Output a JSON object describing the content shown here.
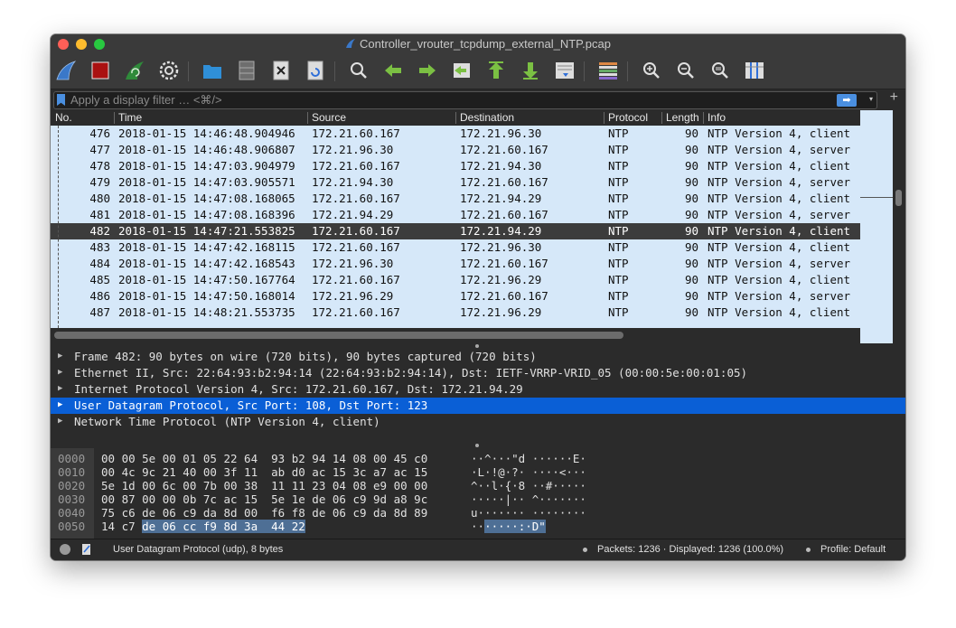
{
  "window": {
    "title": "Controller_vrouter_tcpdump_external_NTP.pcap"
  },
  "toolbar": {
    "buttons": [
      {
        "name": "start-capture",
        "icon": "shark-fin-icon"
      },
      {
        "name": "stop-capture",
        "icon": "stop-square-icon"
      },
      {
        "name": "restart-capture",
        "icon": "restart-fin-icon"
      },
      {
        "name": "capture-options",
        "icon": "gear-icon"
      },
      {
        "name": "open-file",
        "icon": "folder-icon"
      },
      {
        "name": "save-file",
        "icon": "file-cabinet-icon"
      },
      {
        "name": "close-file",
        "icon": "close-file-icon"
      },
      {
        "name": "reload-file",
        "icon": "reload-icon"
      },
      {
        "name": "find-packet",
        "icon": "magnifier-icon"
      },
      {
        "name": "go-back",
        "icon": "arrow-left-icon"
      },
      {
        "name": "go-forward",
        "icon": "arrow-right-icon"
      },
      {
        "name": "go-to-packet",
        "icon": "goto-packet-icon"
      },
      {
        "name": "go-first",
        "icon": "arrow-up-icon"
      },
      {
        "name": "go-last",
        "icon": "arrow-down-icon"
      },
      {
        "name": "auto-scroll",
        "icon": "autoscroll-icon"
      },
      {
        "name": "colorize",
        "icon": "colorize-icon"
      },
      {
        "name": "zoom-in",
        "icon": "zoom-in-icon"
      },
      {
        "name": "zoom-out",
        "icon": "zoom-out-icon"
      },
      {
        "name": "normal-size",
        "icon": "zoom-reset-icon"
      },
      {
        "name": "resize-columns",
        "icon": "resize-columns-icon"
      }
    ]
  },
  "filter": {
    "placeholder": "Apply a display filter … <⌘/>",
    "apply_icon": "➡",
    "dropdown_icon": "▾",
    "add_icon": "+"
  },
  "packet_list": {
    "columns": [
      "No.",
      "Time",
      "Source",
      "Destination",
      "Protocol",
      "Length",
      "Info"
    ],
    "rows": [
      {
        "no": "476",
        "time": "2018-01-15 14:46:48.904946",
        "src": "172.21.60.167",
        "dst": "172.21.96.30",
        "proto": "NTP",
        "len": "90",
        "info": "NTP Version 4, client"
      },
      {
        "no": "477",
        "time": "2018-01-15 14:46:48.906807",
        "src": "172.21.96.30",
        "dst": "172.21.60.167",
        "proto": "NTP",
        "len": "90",
        "info": "NTP Version 4, server"
      },
      {
        "no": "478",
        "time": "2018-01-15 14:47:03.904979",
        "src": "172.21.60.167",
        "dst": "172.21.94.30",
        "proto": "NTP",
        "len": "90",
        "info": "NTP Version 4, client"
      },
      {
        "no": "479",
        "time": "2018-01-15 14:47:03.905571",
        "src": "172.21.94.30",
        "dst": "172.21.60.167",
        "proto": "NTP",
        "len": "90",
        "info": "NTP Version 4, server"
      },
      {
        "no": "480",
        "time": "2018-01-15 14:47:08.168065",
        "src": "172.21.60.167",
        "dst": "172.21.94.29",
        "proto": "NTP",
        "len": "90",
        "info": "NTP Version 4, client"
      },
      {
        "no": "481",
        "time": "2018-01-15 14:47:08.168396",
        "src": "172.21.94.29",
        "dst": "172.21.60.167",
        "proto": "NTP",
        "len": "90",
        "info": "NTP Version 4, server"
      },
      {
        "no": "482",
        "time": "2018-01-15 14:47:21.553825",
        "src": "172.21.60.167",
        "dst": "172.21.94.29",
        "proto": "NTP",
        "len": "90",
        "info": "NTP Version 4, client",
        "selected": true
      },
      {
        "no": "483",
        "time": "2018-01-15 14:47:42.168115",
        "src": "172.21.60.167",
        "dst": "172.21.96.30",
        "proto": "NTP",
        "len": "90",
        "info": "NTP Version 4, client"
      },
      {
        "no": "484",
        "time": "2018-01-15 14:47:42.168543",
        "src": "172.21.96.30",
        "dst": "172.21.60.167",
        "proto": "NTP",
        "len": "90",
        "info": "NTP Version 4, server"
      },
      {
        "no": "485",
        "time": "2018-01-15 14:47:50.167764",
        "src": "172.21.60.167",
        "dst": "172.21.96.29",
        "proto": "NTP",
        "len": "90",
        "info": "NTP Version 4, client"
      },
      {
        "no": "486",
        "time": "2018-01-15 14:47:50.168014",
        "src": "172.21.96.29",
        "dst": "172.21.60.167",
        "proto": "NTP",
        "len": "90",
        "info": "NTP Version 4, server"
      },
      {
        "no": "487",
        "time": "2018-01-15 14:48:21.553735",
        "src": "172.21.60.167",
        "dst": "172.21.96.29",
        "proto": "NTP",
        "len": "90",
        "info": "NTP Version 4, client"
      }
    ]
  },
  "details": {
    "rows": [
      {
        "text": "Frame 482: 90 bytes on wire (720 bits), 90 bytes captured (720 bits)"
      },
      {
        "text": "Ethernet II, Src: 22:64:93:b2:94:14 (22:64:93:b2:94:14), Dst: IETF-VRRP-VRID_05 (00:00:5e:00:01:05)"
      },
      {
        "text": "Internet Protocol Version 4, Src: 172.21.60.167, Dst: 172.21.94.29"
      },
      {
        "text": "User Datagram Protocol, Src Port: 108, Dst Port: 123",
        "selected": true
      },
      {
        "text": "Network Time Protocol (NTP Version 4, client)"
      }
    ]
  },
  "bytes": {
    "rows": [
      {
        "offset": "0000",
        "hex": "00 00 5e 00 01 05 22 64  93 b2 94 14 08 00 45 c0",
        "ascii": "··^···\"d ······E·"
      },
      {
        "offset": "0010",
        "hex": "00 4c 9c 21 40 00 3f 11  ab d0 ac 15 3c a7 ac 15",
        "ascii": "·L·!@·?· ····<···"
      },
      {
        "offset": "0020",
        "hex": "5e 1d 00 6c 00 7b 00 38  11 11 23 04 08 e9 00 00",
        "ascii": "^··l·{·8 ··#·····"
      },
      {
        "offset": "0030",
        "hex": "00 87 00 00 0b 7c ac 15  5e 1e de 06 c9 9d a8 9c",
        "ascii": "·····|·· ^·······"
      },
      {
        "offset": "0040",
        "hex": "75 c6 de 06 c9 da 8d 00  f6 f8 de 06 c9 da 8d 89",
        "ascii": "u······· ········"
      },
      {
        "offset": "0050",
        "hex_pre": "14 c7 ",
        "hex_hl": "de 06 cc f9 8d 3a  44 22",
        "ascii_pre": "··",
        "ascii_hl": "·····:·D\""
      }
    ]
  },
  "status": {
    "left_text": "User Datagram Protocol (udp), 8 bytes",
    "packets_text": "Packets: 1236 · Displayed: 1236 (100.0%)",
    "profile_text": "Profile: Default"
  }
}
